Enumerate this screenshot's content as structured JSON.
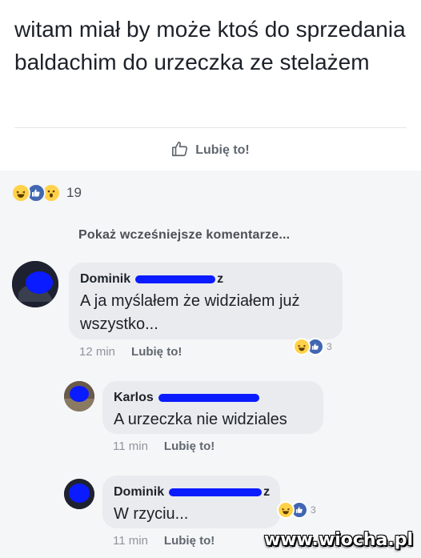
{
  "post": {
    "text": "witam miał by może ktoś do sprzedania baldachim do urzeczka ze stelażem",
    "like_label": "Lubię to!"
  },
  "reactions": {
    "icons": [
      "haha-emoji",
      "like-icon",
      "wow-emoji"
    ],
    "count": "19"
  },
  "prev_comments_label": "Pokaż wcześniejsze komentarze...",
  "comments": [
    {
      "name": "Dominik",
      "name_suffix": "z",
      "text_line1": "A ja myślałem że widziałem już",
      "text_line2": "wszystko...",
      "time": "12 min",
      "like_label": "Lubię to!",
      "reaction_count": "3"
    },
    {
      "name": "Karlos",
      "name_suffix": "",
      "text": "A urzeczka nie widziales",
      "time": "11 min",
      "like_label": "Lubię to!"
    },
    {
      "name": "Dominik",
      "name_suffix": "z",
      "text": "W rzyciu...",
      "time": "11 min",
      "like_label": "Lubię to!",
      "reaction_count": "3"
    }
  ],
  "watermark": "www.wiocha.pl",
  "colors": {
    "like_blue": "#4267b2",
    "emoji_yellow": "#ffd24a",
    "redaction_blue": "#0a1bff",
    "bubble_gray": "#e9ebee"
  }
}
